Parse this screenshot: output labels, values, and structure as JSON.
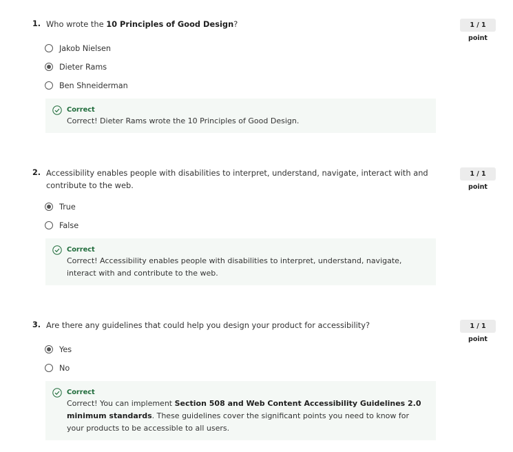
{
  "questions": [
    {
      "number": "1.",
      "text_prefix": "Who wrote the ",
      "text_bold": "10 Principles of Good Design",
      "text_suffix": "?",
      "points": "1 / 1 point",
      "options": [
        {
          "label": "Jakob Nielsen",
          "selected": false
        },
        {
          "label": "Dieter Rams",
          "selected": true
        },
        {
          "label": "Ben Shneiderman",
          "selected": false
        }
      ],
      "feedback_title": "Correct",
      "feedback_text": "Correct! Dieter Rams wrote the 10 Principles of Good Design."
    },
    {
      "number": "2.",
      "text": "Accessibility enables people with disabilities to interpret, understand, navigate, interact with and contribute to the web.",
      "points": "1 / 1 point",
      "options": [
        {
          "label": "True",
          "selected": true
        },
        {
          "label": "False",
          "selected": false
        }
      ],
      "feedback_title": "Correct",
      "feedback_text": "Correct! Accessibility enables people with disabilities to interpret, understand, navigate, interact with and contribute to the web."
    },
    {
      "number": "3.",
      "text": "Are there any guidelines that could help you design your product for accessibility?",
      "points": "1 / 1 point",
      "options": [
        {
          "label": "Yes",
          "selected": true
        },
        {
          "label": "No",
          "selected": false
        }
      ],
      "feedback_title": "Correct",
      "feedback_prefix": "Correct! You can implement ",
      "feedback_bold": "Section 508 and Web Content Accessibility Guidelines 2.0 minimum standards",
      "feedback_suffix": ". These guidelines cover the significant points you need to know for your products to be accessible to all users."
    }
  ],
  "colors": {
    "correct_green": "#1e6b3a",
    "feedback_bg": "#f4f8f5",
    "points_bg": "#ececec"
  }
}
